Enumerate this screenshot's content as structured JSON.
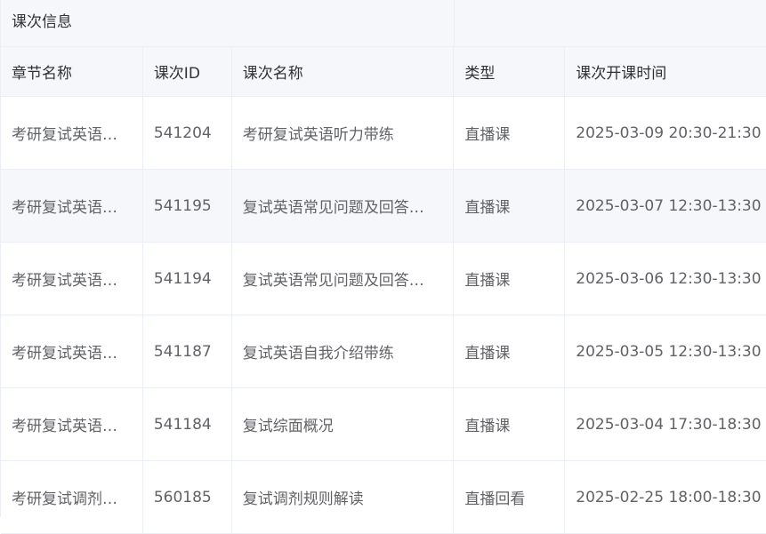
{
  "group_title": "课次信息",
  "headers": [
    "章节名称",
    "课次ID",
    "课次名称",
    "类型",
    "课次开课时间"
  ],
  "rows": [
    {
      "chapter": "考研复试英语…",
      "id": "541204",
      "name": "考研复试英语听力带练",
      "type": "直播课",
      "time": "2025-03-09 20:30-21:30"
    },
    {
      "chapter": "考研复试英语…",
      "id": "541195",
      "name": "复试英语常见问题及回答…",
      "type": "直播课",
      "time": "2025-03-07 12:30-13:30"
    },
    {
      "chapter": "考研复试英语…",
      "id": "541194",
      "name": "复试英语常见问题及回答…",
      "type": "直播课",
      "time": "2025-03-06 12:30-13:30"
    },
    {
      "chapter": "考研复试英语…",
      "id": "541187",
      "name": "复试英语自我介绍带练",
      "type": "直播课",
      "time": "2025-03-05 12:30-13:30"
    },
    {
      "chapter": "考研复试英语…",
      "id": "541184",
      "name": "复试综面概况",
      "type": "直播课",
      "time": "2025-03-04 17:30-18:30"
    },
    {
      "chapter": "考研复试调剂…",
      "id": "560185",
      "name": "复试调剂规则解读",
      "type": "直播回看",
      "time": "2025-02-25 18:00-18:30"
    }
  ]
}
